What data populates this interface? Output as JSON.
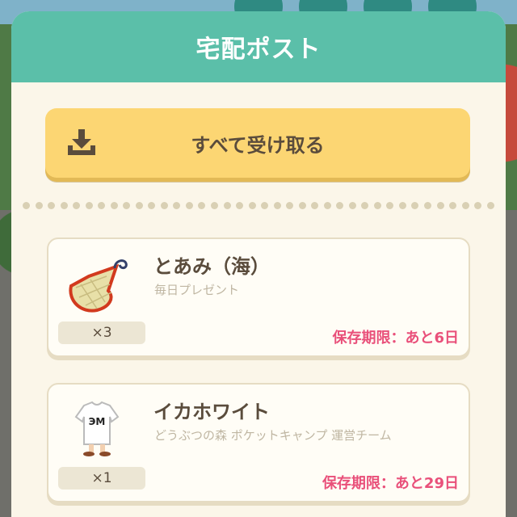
{
  "dialog": {
    "title": "宅配ポスト"
  },
  "receive_all": {
    "label": "すべて受け取る",
    "icon": "download-tray-icon"
  },
  "items": [
    {
      "name": "とあみ（海）",
      "sender": "毎日プレゼント",
      "quantity": "×3",
      "expiry": "保存期限：あと6日",
      "icon": "fishing-net-icon"
    },
    {
      "name": "イカホワイト",
      "sender": "どうぶつの森 ポケットキャンプ 運営チーム",
      "quantity": "×1",
      "expiry": "保存期限：あと29日",
      "icon": "white-tshirt-icon"
    }
  ],
  "colors": {
    "header": "#5bbfa9",
    "button": "#fcd673",
    "expiry": "#e9507a",
    "background": "#fbf6e9"
  }
}
